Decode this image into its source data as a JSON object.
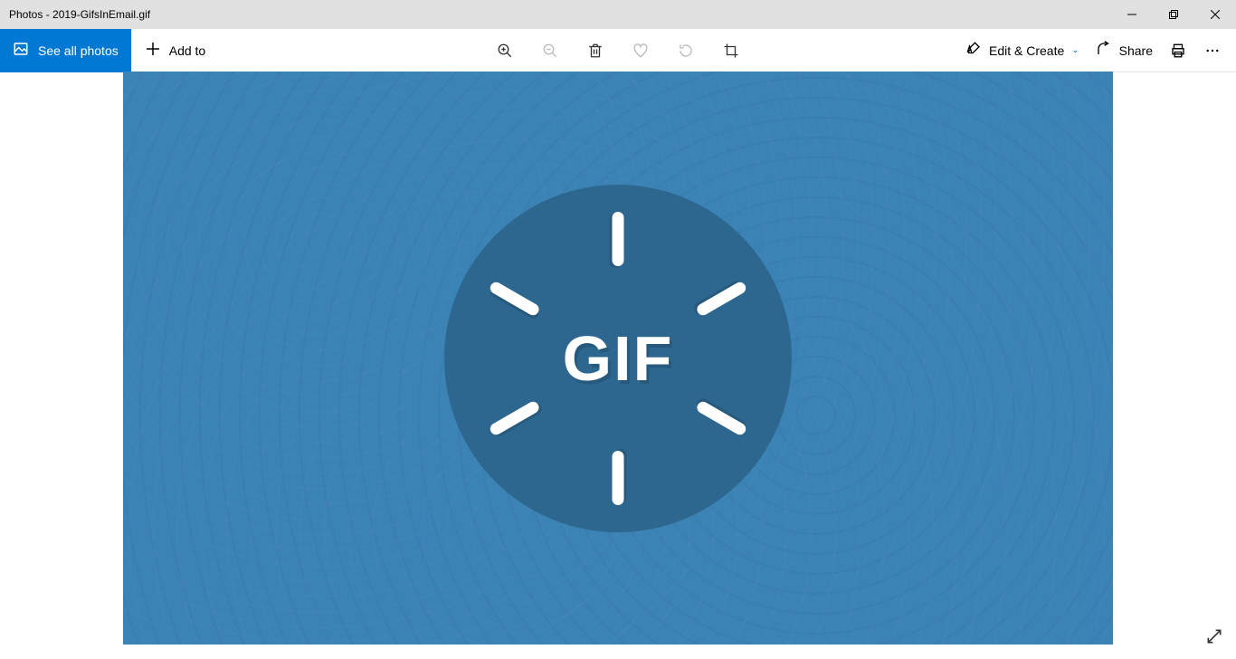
{
  "titlebar": {
    "title": "Photos - 2019-GifsInEmail.gif"
  },
  "toolbar": {
    "see_all_label": "See all photos",
    "add_to_label": "Add to",
    "edit_create_label": "Edit & Create",
    "share_label": "Share"
  },
  "image": {
    "center_text": "GIF",
    "bg_color": "#3b82b5",
    "circle_color": "#2d668f"
  }
}
